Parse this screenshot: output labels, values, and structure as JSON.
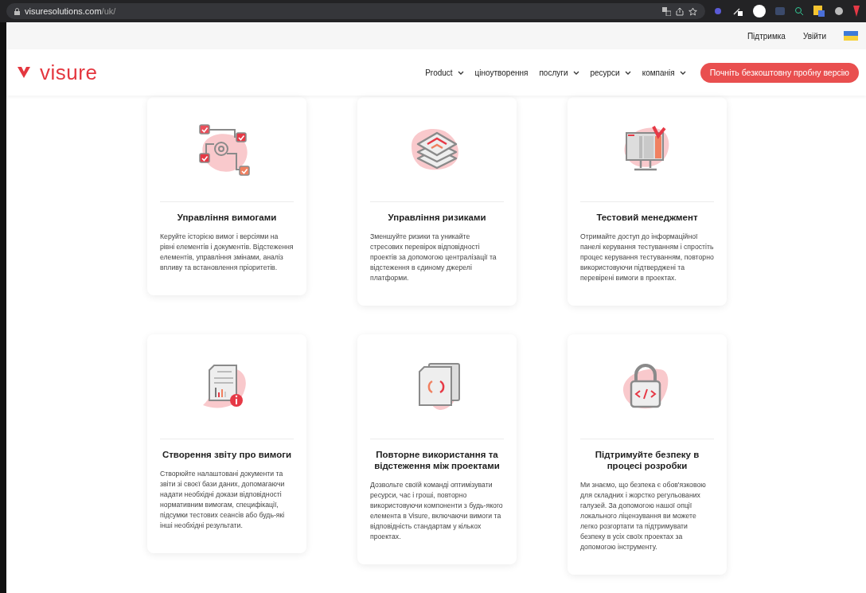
{
  "browser": {
    "host": "visuresolutions.com",
    "path": "/uk/"
  },
  "utility_bar": {
    "links": [
      "Підтримка",
      "Увійти"
    ]
  },
  "nav": {
    "logo": "visure",
    "items": [
      {
        "label": "Product",
        "dropdown": true
      },
      {
        "label": "ціноутворення",
        "dropdown": false
      },
      {
        "label": "послуги",
        "dropdown": true
      },
      {
        "label": "ресурси",
        "dropdown": true
      },
      {
        "label": "компанія",
        "dropdown": true
      }
    ],
    "cta": "Почніть безкоштовну пробну версію"
  },
  "cards": [
    {
      "kind": "checklist",
      "title": "Управління вимогами",
      "text": "Керуйте історією вимог і версіями на рівні елементів і документів. Відстеження елементів, управління змінами, аналіз впливу та встановлення пріоритетів."
    },
    {
      "kind": "layers",
      "title": "Управління ризиками",
      "text": "Зменшуйте ризики та уникайте стресових перевірок відповідності проектів за допомогою централізації та відстеження в єдиному джерелі платформи."
    },
    {
      "kind": "monitor",
      "title": "Тестовий менеджмент",
      "text": "Отримайте доступ до інформаційної панелі керування тестуванням і спростіть процес керування тестуванням, повторно використовуючи підтверджені та перевірені вимоги в проектах."
    },
    {
      "kind": "report",
      "title": "Створення звіту про вимоги",
      "text": "Створюйте налаштовані документи та звіти зі своєї бази даних, допомагаючи надати необхідні докази відповідності нормативним вимогам, специфікації, підсумки тестових сеансів або будь-які інші необхідні результати."
    },
    {
      "kind": "sync",
      "title": "Повторне використання та відстеження між проектами",
      "text": "Дозвольте своїй команді оптимізувати ресурси, час і гроші, повторно використовуючи компоненти з будь-якого елемента в Visure, включаючи вимоги та відповідність стандартам у кількох проектах."
    },
    {
      "kind": "lock",
      "title": "Підтримуйте безпеку в процесі розробки",
      "text": "Ми знаємо, що безпека є обов'язковою для складних і жорстко регульованих галузей. За допомогою нашої опції локального ліцензування ви можете легко розгортати та підтримувати безпеку в усіх своїх проектах за допомогою інструменту."
    }
  ]
}
